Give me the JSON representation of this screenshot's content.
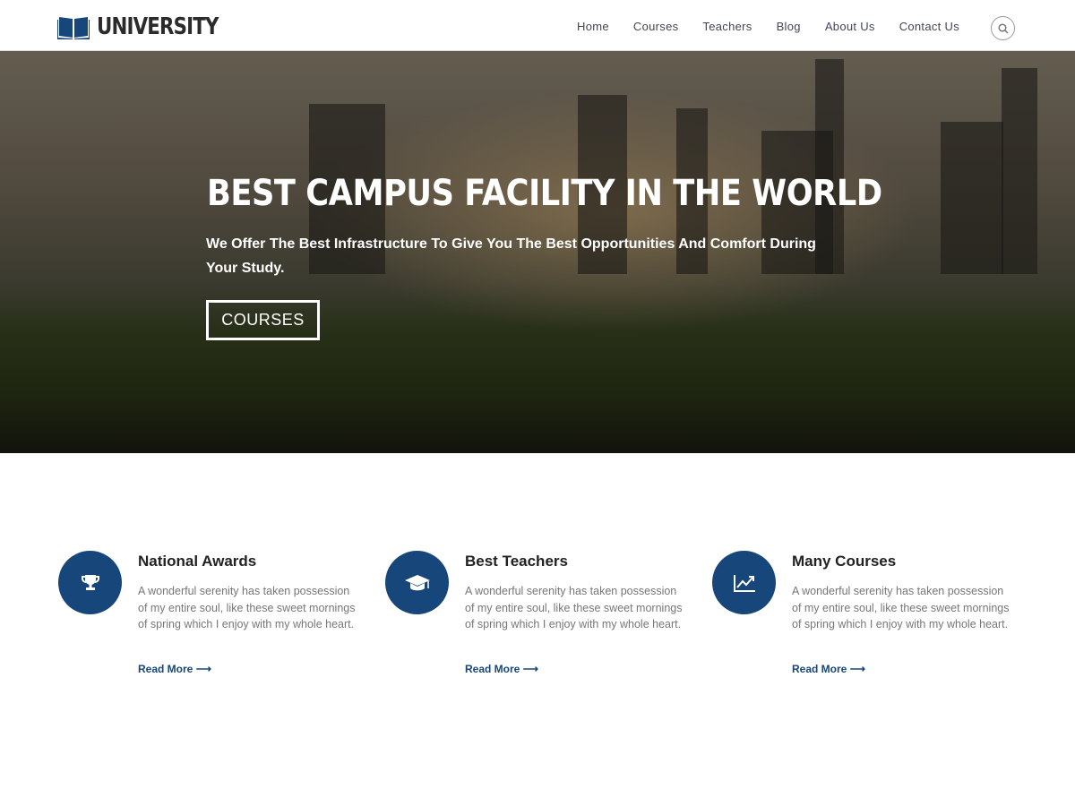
{
  "header": {
    "logo_text": "UNIVERSITY",
    "nav": [
      "Home",
      "Courses",
      "Teachers",
      "Blog",
      "About Us",
      "Contact Us"
    ]
  },
  "hero": {
    "title": "BEST CAMPUS FACILITY IN THE WORLD",
    "subtitle": "We Offer The Best Infrastructure To Give You The Best Opportunities And Comfort During Your Study.",
    "button": "COURSES"
  },
  "colors": {
    "accent": "#17467a"
  },
  "features": [
    {
      "icon": "trophy-icon",
      "title": "National Awards",
      "text": "A wonderful serenity has taken possession of my entire soul, like these sweet mornings of spring which I enjoy with my whole heart.",
      "link": "Read More"
    },
    {
      "icon": "graduation-cap-icon",
      "title": "Best Teachers",
      "text": "A wonderful serenity has taken possession of my entire soul, like these sweet mornings of spring which I enjoy with my whole heart.",
      "link": "Read More"
    },
    {
      "icon": "chart-line-icon",
      "title": "Many Courses",
      "text": "A wonderful serenity has taken possession of my entire soul, like these sweet mornings of spring which I enjoy with my whole heart.",
      "link": "Read More"
    }
  ]
}
